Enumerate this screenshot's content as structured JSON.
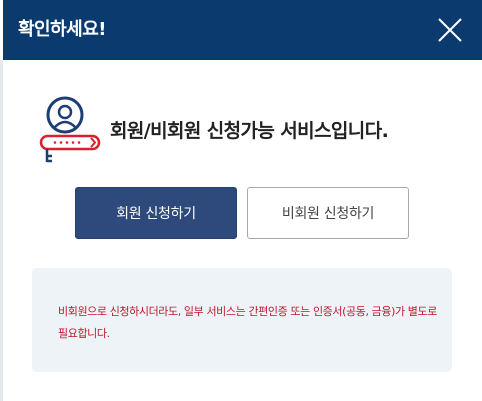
{
  "header": {
    "title": "확인하세요!",
    "close_icon": "close-icon"
  },
  "info": {
    "icon": "user-key-icon",
    "text": "회원/비회원 신청가능 서비스입니다."
  },
  "buttons": {
    "member_label": "회원 신청하기",
    "guest_label": "비회원 신청하기"
  },
  "notice": {
    "text": "비회원으로 신청하시더라도, 일부 서비스는 간편인증 또는 인증서(공동, 금융)가 별도로 필요합니다."
  },
  "colors": {
    "header_bg": "#0a3a6e",
    "primary_button": "#2e4a7d",
    "notice_bg": "#eef3f8",
    "notice_text": "#c0172b",
    "icon_red": "#d8202f",
    "icon_blue": "#1c3f73"
  }
}
